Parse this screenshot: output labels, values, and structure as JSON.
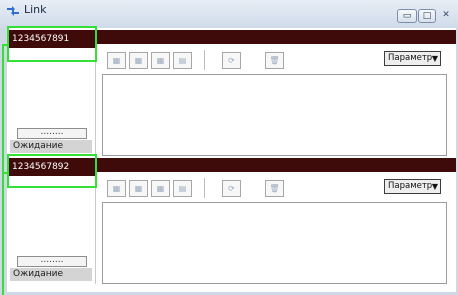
{
  "window": {
    "title": "Link",
    "minimize_glyph": "▭",
    "maximize_glyph": "□",
    "close_glyph": "✕"
  },
  "panes": [
    {
      "id": "1234567891",
      "dots": "........",
      "status": "Ожидание",
      "option_label": "Параметр",
      "toolbar_icons": [
        "connect-icon",
        "copy-icon",
        "move-icon",
        "list-icon",
        "refresh-icon",
        "delete-icon"
      ]
    },
    {
      "id": "1234567892",
      "dots": "........",
      "status": "Ожидание",
      "option_label": "Параметр",
      "toolbar_icons": [
        "connect-icon",
        "copy-icon",
        "move-icon",
        "list-icon",
        "refresh-icon",
        "delete-icon"
      ]
    }
  ],
  "colors": {
    "id_bar": "#3e0a0a",
    "highlight": "#33e033"
  }
}
